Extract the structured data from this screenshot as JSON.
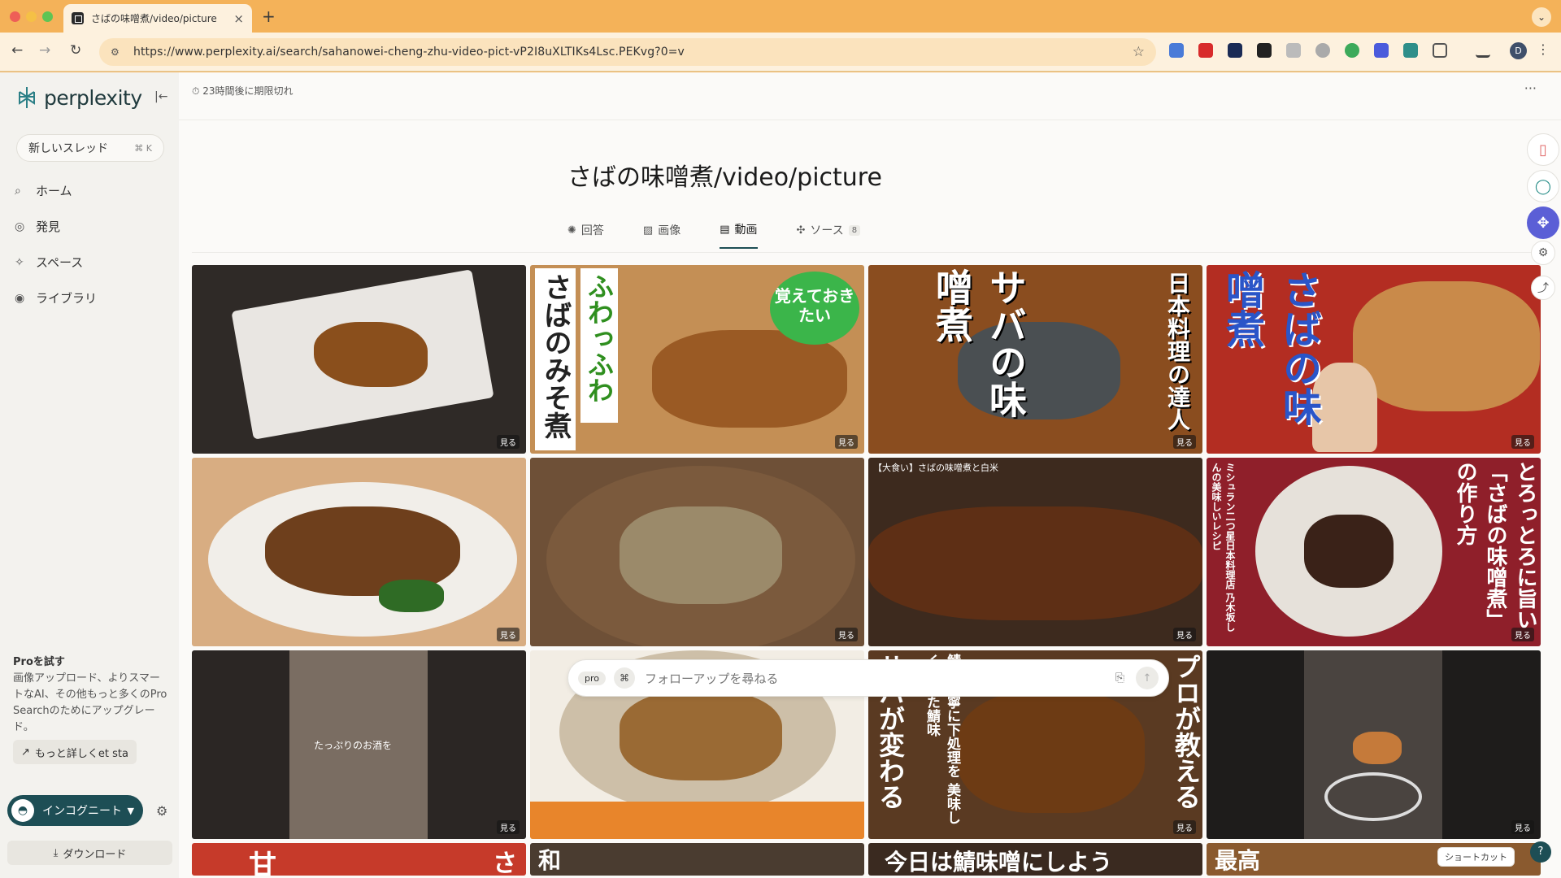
{
  "browser": {
    "tab_title": "さばの味噌煮/video/picture",
    "url": "https://www.perplexity.ai/search/sahanowei-cheng-zhu-video-pict-vP2I8uXLTIKs4Lsc.PEKvg?0=v",
    "profile_initial": "D"
  },
  "sidebar": {
    "brand": "perplexity",
    "new_thread": "新しいスレッド",
    "new_thread_shortcut": "⌘ K",
    "nav": [
      "ホーム",
      "発見",
      "スペース",
      "ライブラリ"
    ],
    "pro_title": "Proを試す",
    "pro_text": "画像アップロード、よりスマートなAI、その他もっと多くのPro Searchのためにアップグレード。",
    "learn_more": "もっと詳しくet sta",
    "incognito": "インコグニート",
    "download": "ダウンロード"
  },
  "main": {
    "expire_text": "23時間後に期限切れ",
    "title": "さばの味噌煮/video/picture",
    "tabs": [
      {
        "label": "回答"
      },
      {
        "label": "画像"
      },
      {
        "label": "動画",
        "active": true
      },
      {
        "label": "ソース",
        "count": "8"
      }
    ],
    "watch_label": "見る",
    "video_overlay_title": "【大食い】さばの味噌煮と白米",
    "followup_placeholder": "フォローアップを尋ねる",
    "pro_badge": "pro",
    "shortcut_label": "ショートカット",
    "help": "?"
  },
  "thumbnails": [
    {
      "bg": "#3a3430",
      "caption": ""
    },
    {
      "bg": "#c88c4a",
      "caption": "さばのみそ煮",
      "caption2": "ふわっふわ",
      "badge": "覚えておきたい"
    },
    {
      "bg": "#8a4d1f",
      "caption": "サバの味噌煮",
      "caption2": "日本料理の達人"
    },
    {
      "bg": "#b32d22",
      "caption": "さばの味噌煮"
    },
    {
      "bg": "#d4a679",
      "caption": ""
    },
    {
      "bg": "#6e5037",
      "caption": ""
    },
    {
      "bg": "#3d2a1e",
      "caption": ""
    },
    {
      "bg": "#8f1f2a",
      "caption": "とろっとろに旨い「さばの味噌煮」の作り方",
      "caption2": "ミシュラン二つ星日本料理店 乃木坂しんの美味しいレシピ"
    },
    {
      "bg": "#2b2624",
      "caption": "",
      "small": "たっぷりのお酒を"
    },
    {
      "bg": "#d9cdb8",
      "caption": ""
    },
    {
      "bg": "#5a3a22",
      "caption": "プロが教える",
      "caption2": "サバが変わる",
      "caption3": "鯖を丁寧に下処理を 美味しく炊いた鯖味"
    },
    {
      "bg": "#1e1c1b",
      "caption": ""
    }
  ],
  "bottom_row_text": [
    "甘",
    "さ",
    "和",
    "今日は鯖味噌にしよう",
    "最高"
  ]
}
